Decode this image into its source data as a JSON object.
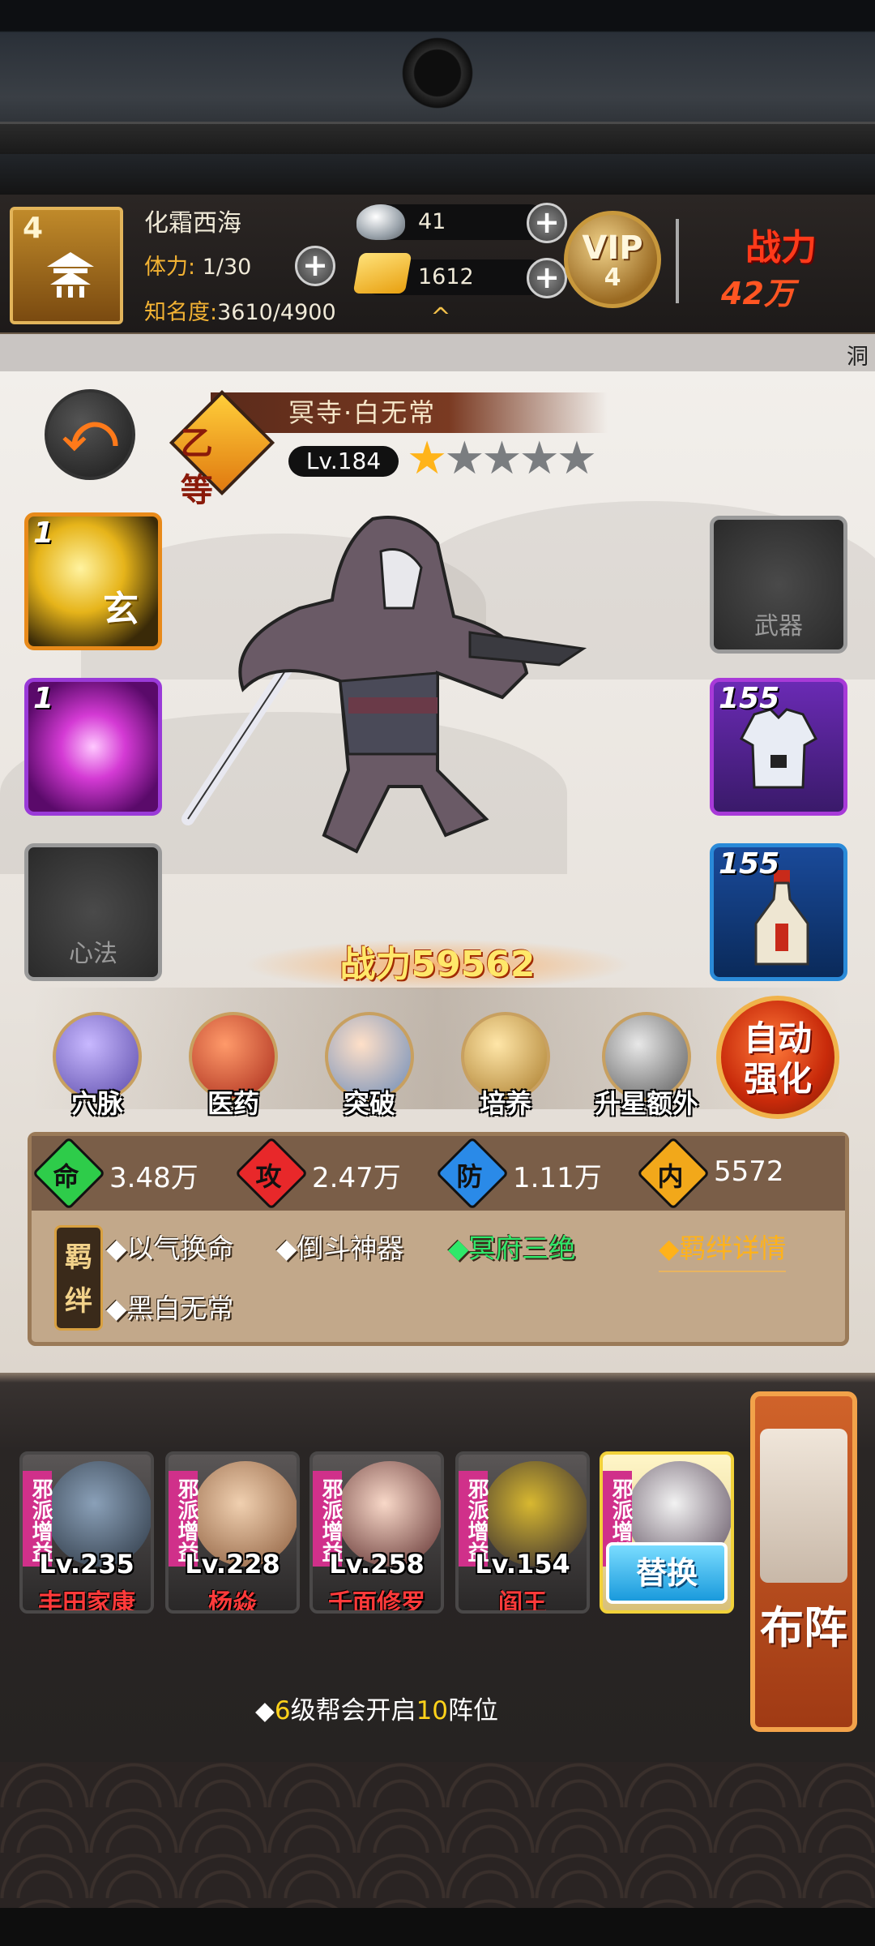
{
  "header": {
    "level": "4",
    "player_name": "化霜西海",
    "stamina_label": "体力:",
    "stamina_value": "1/30",
    "fame_label": "知名度:",
    "fame_value": "3610/4900",
    "silver": "41",
    "gold": "1612",
    "vip_label": "VIP",
    "vip_level": "4",
    "power_label": "战力",
    "power_value": "42万",
    "plus": "+",
    "expand": "^"
  },
  "band": {
    "right_text": "洞"
  },
  "hero": {
    "name": "冥寺·白无常",
    "grade": "乙等",
    "level": "Lv.184",
    "stars_filled": 1,
    "stars_total": 5,
    "power": "战力59562"
  },
  "slots": {
    "xuan_count": "1",
    "xuan_char": "玄",
    "purple_count": "1",
    "xinfa_label": "心法",
    "wuqi_label": "武器",
    "armor_count": "155",
    "potion_count": "155"
  },
  "functions": {
    "xuemai": "穴脉",
    "yiyao": "医药",
    "tupo": "突破",
    "peiyang": "培养",
    "shengxing": "升星额外",
    "auto_line1": "自动",
    "auto_line2": "强化"
  },
  "stats": {
    "hp_icon": "命",
    "hp": "3.48万",
    "atk_icon": "攻",
    "atk": "2.47万",
    "def_icon": "防",
    "def": "1.11万",
    "inner_icon": "内",
    "inner": "5572"
  },
  "bonds": {
    "tag": "羁绊",
    "b1": "◆以气换命",
    "b2": "◆倒斗神器",
    "b3": "◆冥府三绝",
    "b4": "◆黑白无常",
    "detail": "◆羁绊详情"
  },
  "lineup": {
    "tag": "邪派增益",
    "members": [
      {
        "level": "Lv.235",
        "name": "丰田家康"
      },
      {
        "level": "Lv.228",
        "name": "杨焱"
      },
      {
        "level": "Lv.258",
        "name": "千面修罗"
      },
      {
        "level": "Lv.154",
        "name": "阎王"
      }
    ],
    "swap_label": "替换",
    "formation_label": "布阵"
  },
  "notice": {
    "p1": "◆",
    "n1": "6",
    "p2": "级帮会开启",
    "n2": "10",
    "p3": "阵位"
  },
  "colors": {
    "accent_gold": "#f2b233",
    "hp": "#2ecc4a",
    "atk": "#e8282a",
    "def": "#2a8ae8",
    "inner": "#f2a81a"
  },
  "icons": [
    "pagoda-icon",
    "silver-ingot-icon",
    "gold-ingot-icon",
    "back-arrow-icon",
    "star-icon"
  ]
}
